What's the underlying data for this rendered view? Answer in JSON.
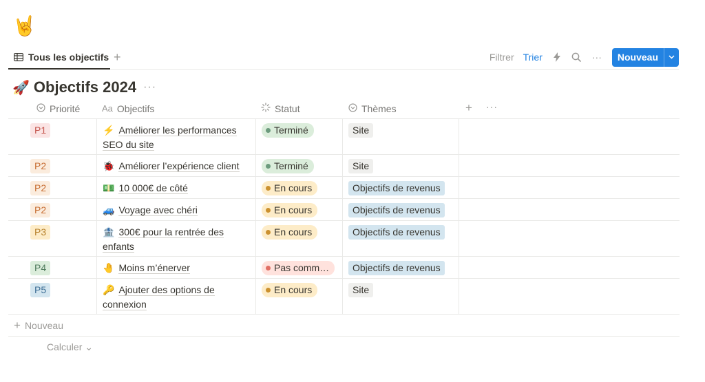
{
  "page": {
    "icon": "🤘"
  },
  "view": {
    "tab_label": "Tous les objectifs",
    "add_view": "+"
  },
  "toolbar": {
    "filter": "Filtrer",
    "sort": "Trier",
    "lightning": "⚡",
    "search": "⌕",
    "more": "···",
    "new_label": "Nouveau",
    "new_caret": "⌄"
  },
  "database": {
    "emoji": "🚀",
    "title": "Objectifs 2024",
    "more": "···"
  },
  "columns": {
    "priority": "Priorité",
    "goals": "Objectifs",
    "goals_icon": "Aa",
    "status": "Statut",
    "themes": "Thèmes",
    "add": "+",
    "more": "···"
  },
  "rows": [
    {
      "priority": "P1",
      "priority_bg": "#fbe4e4",
      "priority_fg": "#c4554d",
      "emoji": "⚡",
      "goal": "Améliorer les performances SEO du site",
      "status": "Terminé",
      "status_bg": "#dbeddb",
      "status_dot": "#6c9b7d",
      "theme": "Site",
      "theme_bg": "#efefed",
      "height": 52
    },
    {
      "priority": "P2",
      "priority_bg": "#fbecdd",
      "priority_fg": "#c76e33",
      "emoji": "🐞",
      "goal": "Améliorer l’expérience client",
      "status": "Terminé",
      "status_bg": "#dbeddb",
      "status_dot": "#6c9b7d",
      "theme": "Site",
      "theme_bg": "#efefed",
      "height": 32
    },
    {
      "priority": "P2",
      "priority_bg": "#fbecdd",
      "priority_fg": "#c76e33",
      "emoji": "💵",
      "goal": "10 000€ de côté",
      "status": "En cours",
      "status_bg": "#fdecc8",
      "status_dot": "#cb912f",
      "theme": "Objectifs de revenus",
      "theme_bg": "#d3e5ef",
      "height": 32
    },
    {
      "priority": "P2",
      "priority_bg": "#fbecdd",
      "priority_fg": "#c76e33",
      "emoji": "🚙",
      "goal": "Voyage avec chéri",
      "status": "En cours",
      "status_bg": "#fdecc8",
      "status_dot": "#cb912f",
      "theme": "Objectifs de revenus",
      "theme_bg": "#d3e5ef",
      "height": 32
    },
    {
      "priority": "P3",
      "priority_bg": "#fdecc8",
      "priority_fg": "#b7812c",
      "emoji": "🏦",
      "goal": "300€ pour la rentrée des enfants",
      "status": "En cours",
      "status_bg": "#fdecc8",
      "status_dot": "#cb912f",
      "theme": "Objectifs de revenus",
      "theme_bg": "#d3e5ef",
      "height": 52
    },
    {
      "priority": "P4",
      "priority_bg": "#dbeddb",
      "priority_fg": "#4f7a5c",
      "emoji": "🤚",
      "goal": "Moins m’énerver",
      "status": "Pas comm…",
      "status_bg": "#ffe2dd",
      "status_dot": "#e16f64",
      "theme": "Objectifs de revenus",
      "theme_bg": "#d3e5ef",
      "height": 32
    },
    {
      "priority": "P5",
      "priority_bg": "#d3e5ef",
      "priority_fg": "#3d6e95",
      "emoji": "🔑",
      "goal": "Ajouter des options de connexion",
      "status": "En cours",
      "status_bg": "#fdecc8",
      "status_dot": "#cb912f",
      "theme": "Site",
      "theme_bg": "#efefed",
      "height": 52
    }
  ],
  "footer": {
    "new_row_plus": "+",
    "new_row": "Nouveau",
    "calculate": "Calculer ⌄"
  }
}
